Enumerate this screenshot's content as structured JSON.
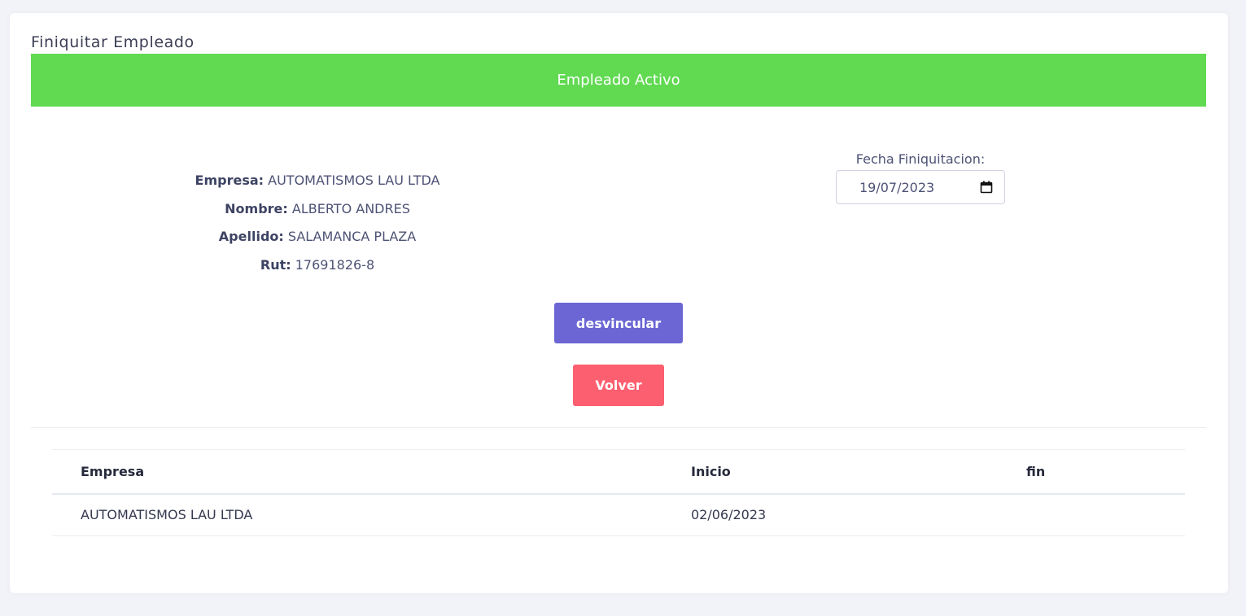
{
  "page": {
    "title": "Finiquitar Empleado"
  },
  "status": {
    "label": "Empleado Activo",
    "color": "#61da52"
  },
  "employee": {
    "empresa_label": "Empresa:",
    "empresa": "AUTOMATISMOS LAU LTDA",
    "nombre_label": "Nombre:",
    "nombre": "ALBERTO ANDRES",
    "apellido_label": "Apellido:",
    "apellido": "SALAMANCA PLAZA",
    "rut_label": "Rut:",
    "rut": "17691826-8"
  },
  "date_field": {
    "label": "Fecha Finiquitacion:",
    "value": "19/07/2023",
    "icon": "calendar-icon"
  },
  "actions": {
    "primary_label": "desvincular",
    "primary_color": "#6b66d3",
    "back_label": "Volver",
    "back_color": "#fc5f6f"
  },
  "history_table": {
    "headers": [
      "Empresa",
      "Inicio",
      "fin"
    ],
    "rows": [
      [
        "AUTOMATISMOS LAU LTDA",
        "02/06/2023",
        ""
      ]
    ]
  }
}
